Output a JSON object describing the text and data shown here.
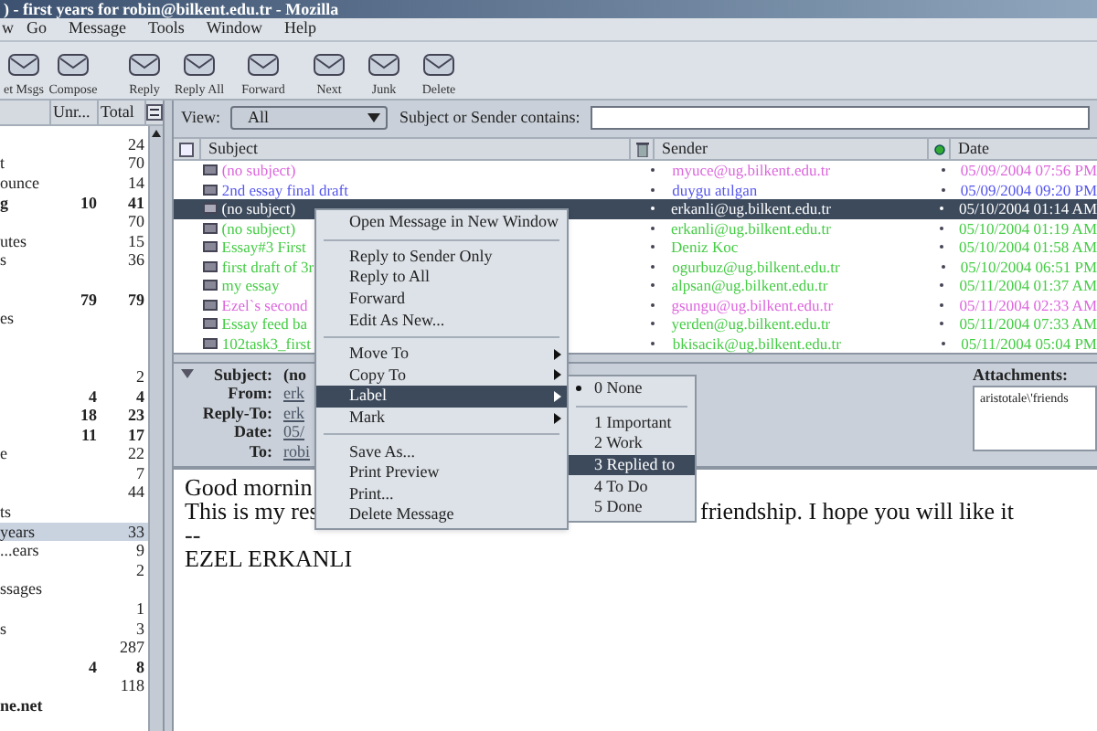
{
  "window": {
    "title": ") - first years for robin@bilkent.edu.tr - Mozilla"
  },
  "menu_bar": [
    "w",
    "Go",
    "Message",
    "Tools",
    "Window",
    "Help"
  ],
  "toolbar": [
    "et Msgs",
    "Compose",
    "Reply",
    "Reply All",
    "Forward",
    "Next",
    "Junk",
    "Delete"
  ],
  "folder_pane": {
    "columns": [
      "Unr...",
      "Total"
    ],
    "rows": [
      {
        "total": "24",
        "selected": false
      },
      {
        "name": "t",
        "total": "70",
        "selected": false
      },
      {
        "name": "ounce",
        "total": "14",
        "selected": false
      },
      {
        "name": "g",
        "unread": "10",
        "total": "41",
        "bold": true,
        "selected": false
      },
      {
        "total": "70",
        "selected": false
      },
      {
        "name": "utes",
        "total": "15",
        "selected": false
      },
      {
        "name": "s",
        "total": "36",
        "selected": false
      },
      {
        "selected": false
      },
      {
        "unread": "79",
        "total": "79",
        "bold": true,
        "selected": false
      },
      {
        "name": "es",
        "selected": false
      },
      {
        "selected": false
      },
      {
        "selected": false
      },
      {
        "total": "2",
        "selected": false
      },
      {
        "unread": "4",
        "total": "4",
        "bold": true,
        "selected": false
      },
      {
        "unread": "18",
        "total": "23",
        "bold": true,
        "selected": false
      },
      {
        "unread": "11",
        "total": "17",
        "bold": true,
        "selected": false
      },
      {
        "name": "e",
        "total": "22",
        "selected": false
      },
      {
        "total": "7",
        "selected": false
      },
      {
        "total": "44",
        "selected": false
      },
      {
        "name": "ts",
        "selected": false
      },
      {
        "name": "years",
        "total": "33",
        "selected": true
      },
      {
        "name": "...ears",
        "total": "9",
        "selected": false
      },
      {
        "total": "2",
        "selected": false
      },
      {
        "name": "ssages",
        "selected": false
      },
      {
        "total": "1",
        "selected": false
      },
      {
        "name": "s",
        "total": "3",
        "selected": false
      },
      {
        "total": "287",
        "selected": false
      },
      {
        "unread": "4",
        "total": "8",
        "bold": true,
        "selected": false
      },
      {
        "total": "118",
        "selected": false
      },
      {
        "name": "ne.net",
        "bold": true,
        "selected": false
      }
    ]
  },
  "view_bar": {
    "view_label": "View:",
    "view_value": "All",
    "search_label": "Subject or Sender contains:"
  },
  "thread_pane": {
    "columns": [
      "Subject",
      "Sender",
      "Date"
    ],
    "rows": [
      {
        "subject": "(no subject)",
        "sender": "myuce@ug.bilkent.edu.tr",
        "date": "05/09/2004 07:56 PM",
        "color": "#dd66dd",
        "selected": false
      },
      {
        "subject": "2nd essay final draft",
        "sender": "duygu atılgan",
        "date": "05/09/2004 09:20 PM",
        "color": "#5555ee",
        "selected": false
      },
      {
        "subject": "(no subject)",
        "sender": "erkanli@ug.bilkent.edu.tr",
        "date": "05/10/2004 01:14 AM",
        "selected": true
      },
      {
        "subject": "(no subject)",
        "sender": "erkanli@ug.bilkent.edu.tr",
        "date": "05/10/2004 01:19 AM",
        "color": "#44cc44",
        "selected": false
      },
      {
        "subject": "Essay#3 First",
        "sender": "Deniz Koc",
        "date": "05/10/2004 01:58 AM",
        "color": "#44cc44",
        "selected": false
      },
      {
        "subject": "first draft of 3r",
        "sender": "ogurbuz@ug.bilkent.edu.tr",
        "date": "05/10/2004 06:51 PM",
        "color": "#44cc44",
        "selected": false
      },
      {
        "subject": "my essay",
        "sender": "alpsan@ug.bilkent.edu.tr",
        "date": "05/11/2004 01:37 AM",
        "color": "#44cc44",
        "selected": false
      },
      {
        "subject": "Ezel`s second",
        "sender": "gsungu@ug.bilkent.edu.tr",
        "date": "05/11/2004 02:33 AM",
        "color": "#dd66dd",
        "selected": false
      },
      {
        "subject": "Essay feed ba",
        "sender": "yerden@ug.bilkent.edu.tr",
        "date": "05/11/2004 07:33 AM",
        "color": "#44cc44",
        "selected": false
      },
      {
        "subject": "102task3_first",
        "sender": "bkisacik@ug.bilkent.edu.tr",
        "date": "05/11/2004 05:04 PM",
        "color": "#44cc44",
        "selected": false
      }
    ]
  },
  "message_header": {
    "fields": [
      {
        "label": "Subject:",
        "value": "(no"
      },
      {
        "label": "From:",
        "value": "erk"
      },
      {
        "label": "Reply-To:",
        "value": "erk"
      },
      {
        "label": "Date:",
        "value": "05/"
      },
      {
        "label": "To:",
        "value": "robi"
      }
    ],
    "attachments_label": "Attachments:",
    "attachments": [
      "aristotale\\'friends"
    ]
  },
  "message_body": {
    "lines": [
      [
        "Good mornin"
      ],
      [
        "This is my res",
        "friendship. I hope you will like it"
      ],
      [
        "--"
      ],
      [
        "EZEL ERKANLI"
      ]
    ]
  },
  "context_menu": [
    {
      "kind": "item",
      "label": "Open Message in New Window",
      "submenu": false,
      "selected": false
    },
    {
      "kind": "separator"
    },
    {
      "kind": "item",
      "label": "Reply to Sender Only",
      "submenu": false,
      "selected": false
    },
    {
      "kind": "item",
      "label": "Reply to All",
      "submenu": false,
      "selected": false
    },
    {
      "kind": "item",
      "label": "Forward",
      "submenu": false,
      "selected": false
    },
    {
      "kind": "item",
      "label": "Edit As New...",
      "submenu": false,
      "selected": false
    },
    {
      "kind": "separator"
    },
    {
      "kind": "item",
      "label": "Move To",
      "submenu": true,
      "selected": false
    },
    {
      "kind": "item",
      "label": "Copy To",
      "submenu": true,
      "selected": false
    },
    {
      "kind": "item",
      "label": "Label",
      "submenu": true,
      "selected": true
    },
    {
      "kind": "item",
      "label": "Mark",
      "submenu": true,
      "selected": false
    },
    {
      "kind": "separator"
    },
    {
      "kind": "item",
      "label": "Save As...",
      "submenu": false,
      "selected": false
    },
    {
      "kind": "item",
      "label": "Print Preview",
      "submenu": false,
      "selected": false
    },
    {
      "kind": "item",
      "label": "Print...",
      "submenu": false,
      "selected": false
    },
    {
      "kind": "item",
      "label": "Delete Message",
      "submenu": false,
      "selected": false
    }
  ],
  "label_submenu": [
    {
      "kind": "item",
      "label": "0 None",
      "checked": true,
      "selected": false
    },
    {
      "kind": "separator"
    },
    {
      "kind": "item",
      "label": "1 Important",
      "checked": false,
      "selected": false
    },
    {
      "kind": "item",
      "label": "2 Work",
      "checked": false,
      "selected": false
    },
    {
      "kind": "item",
      "label": "3 Replied to",
      "checked": false,
      "selected": true
    },
    {
      "kind": "item",
      "label": "4 To Do",
      "checked": false,
      "selected": false
    },
    {
      "kind": "item",
      "label": "5 Done",
      "checked": false,
      "selected": false
    }
  ]
}
